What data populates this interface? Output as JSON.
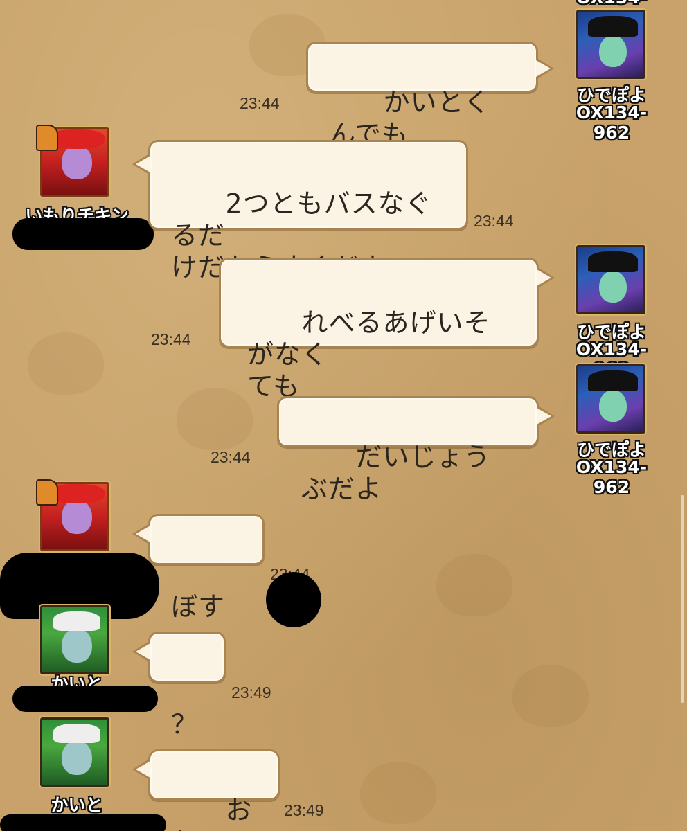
{
  "users": {
    "hidepoyo": {
      "name": "ひでぽよ",
      "id": "OX134-962"
    },
    "imori": {
      "name": "いもりチキン"
    },
    "kaito": {
      "name": "かいと"
    }
  },
  "top_partial_id": "OX134-962",
  "messages": [
    {
      "sender": "ひでぽよ",
      "text": "かいとくんでも",
      "time": "23:44"
    },
    {
      "sender": "いもりチキン",
      "text": "2つともバスなぐるだ\nけだからすぐだよ",
      "time": "23:44"
    },
    {
      "sender": "ひでぽよ",
      "text": "れべるあげいそがなく\nても",
      "time": "23:44"
    },
    {
      "sender": "ひでぽよ",
      "text": "だいじょうぶだよ",
      "time": "23:44"
    },
    {
      "sender": "いもりチキン",
      "text": "ぼすw",
      "time": "23:44"
    },
    {
      "sender": "かいと",
      "text": "？",
      "time": "23:49"
    },
    {
      "sender": "かいと",
      "text": "おれ？",
      "time": "23:49"
    }
  ],
  "colors": {
    "background": "#c8a26a",
    "bubble": "#fbf3e4",
    "bubble_border": "#a98451",
    "redaction": "#000000"
  },
  "icons": {
    "hidepoyo_avatar": "avatar-hidepoyo-icon",
    "imori_avatar": "avatar-imori-icon",
    "kaito_avatar": "avatar-kaito-icon",
    "imori_badge": "trumpet-badge-icon"
  }
}
